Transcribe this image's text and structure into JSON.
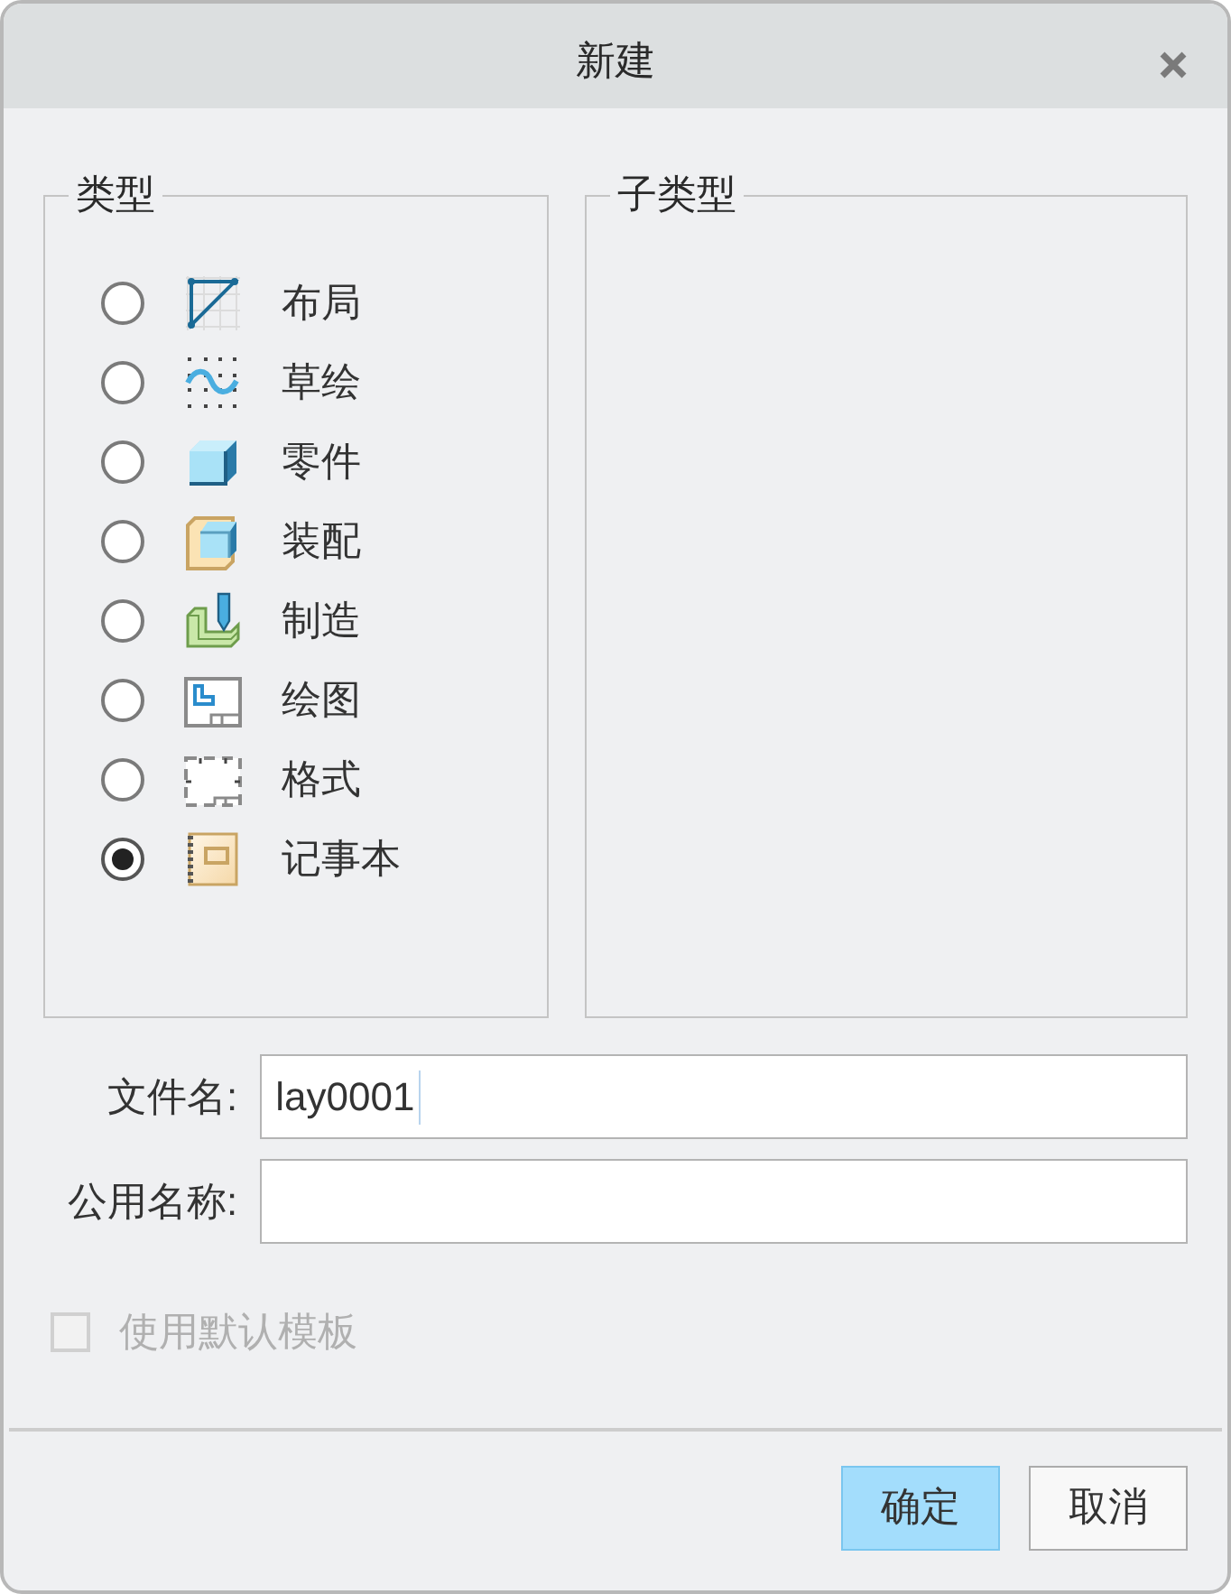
{
  "window": {
    "title": "新建"
  },
  "type_group": {
    "label": "类型",
    "items": [
      {
        "label": "布局",
        "kind": "layout",
        "selected": false
      },
      {
        "label": "草绘",
        "kind": "sketch",
        "selected": false
      },
      {
        "label": "零件",
        "kind": "part",
        "selected": false
      },
      {
        "label": "装配",
        "kind": "assembly",
        "selected": false
      },
      {
        "label": "制造",
        "kind": "manufacturing",
        "selected": false
      },
      {
        "label": "绘图",
        "kind": "drawing",
        "selected": false
      },
      {
        "label": "格式",
        "kind": "format",
        "selected": false
      },
      {
        "label": "记事本",
        "kind": "notebook",
        "selected": true
      }
    ]
  },
  "subtype_group": {
    "label": "子类型"
  },
  "fields": [
    {
      "label": "文件名:",
      "value": "lay0001",
      "focused": true
    },
    {
      "label": "公用名称:",
      "focused": false
    }
  ],
  "template_checkbox": {
    "label": "使用默认模板",
    "checked": false,
    "disabled": true
  },
  "buttons": [
    {
      "label": "确定",
      "default": true
    },
    {
      "label": "取消",
      "default": false
    }
  ]
}
